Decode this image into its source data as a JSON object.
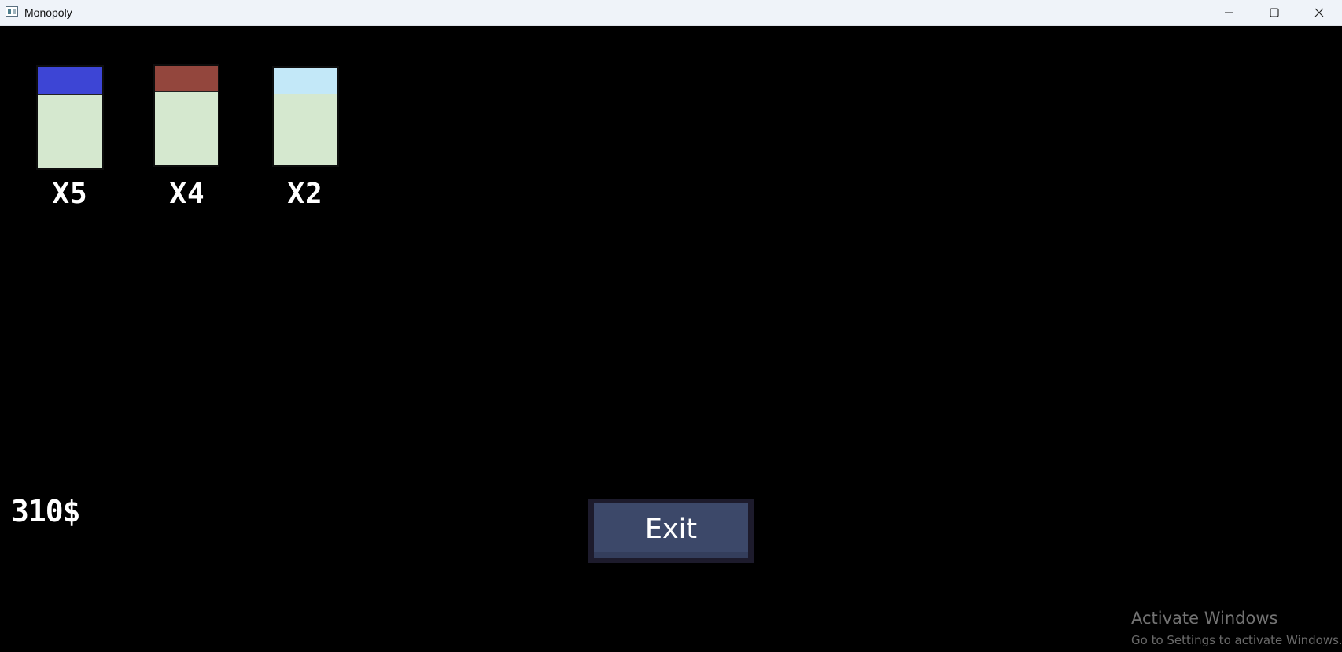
{
  "window": {
    "title": "Monopoly",
    "app_icon": "window-app-icon",
    "controls": {
      "minimize_icon": "minimize-icon",
      "maximize_icon": "maximize-icon",
      "close_icon": "close-icon"
    }
  },
  "cards": [
    {
      "color": "#3d45d5",
      "count": "X5"
    },
    {
      "color": "#93463d",
      "count": "X4"
    },
    {
      "color": "#c3e8f8",
      "count": "X2"
    }
  ],
  "player": {
    "money": "310$"
  },
  "exit_button": {
    "label": "Exit"
  },
  "watermark": {
    "title": "Activate Windows",
    "subtitle": "Go to Settings to activate Windows."
  }
}
